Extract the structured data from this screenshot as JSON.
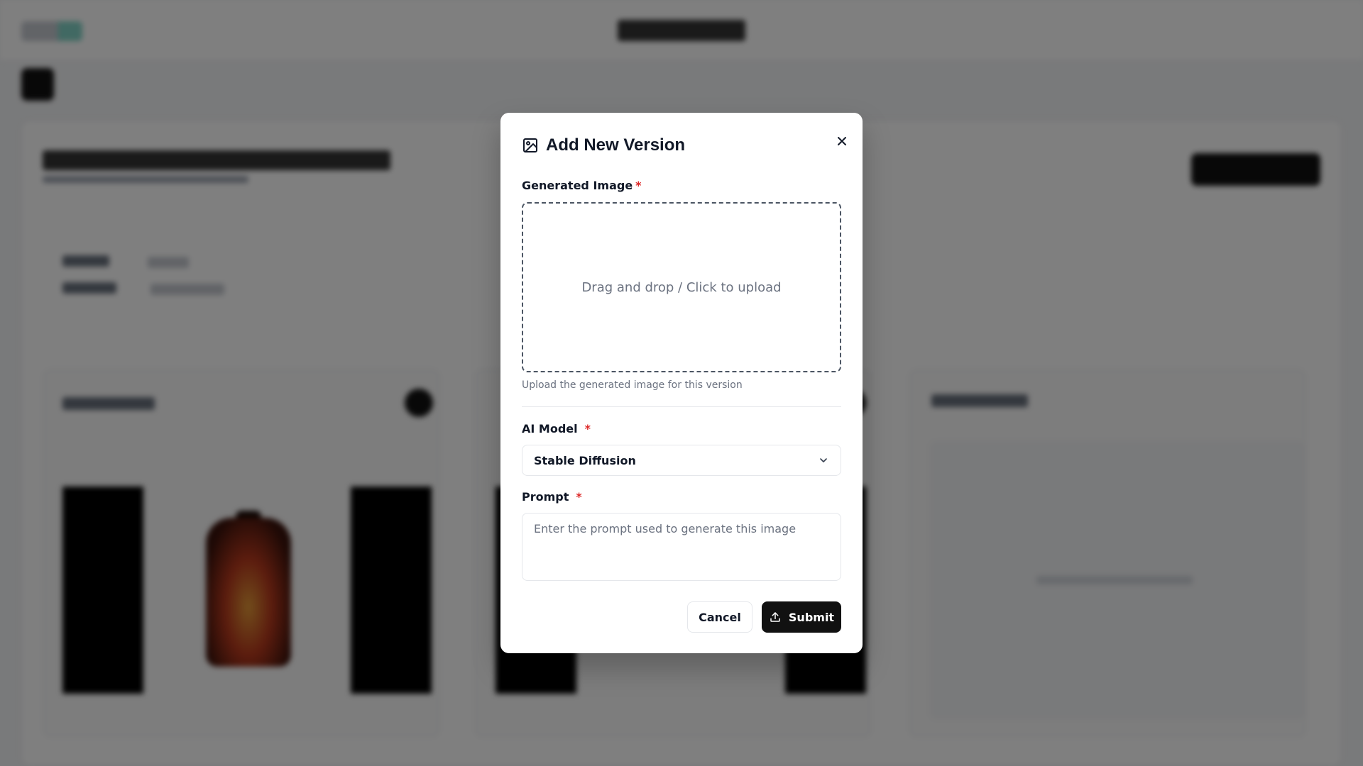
{
  "modal": {
    "title": "Add New Version",
    "title_icon": "image-icon",
    "close_icon": "close-icon",
    "generated_image": {
      "label": "Generated Image",
      "required_mark": "*",
      "dropzone_text": "Drag and drop / Click to upload",
      "help_text": "Upload the generated image for this version"
    },
    "ai_model": {
      "label": "AI Model",
      "required_mark": "*",
      "selected": "Stable Diffusion",
      "icon": "chevron-down-icon"
    },
    "prompt": {
      "label": "Prompt",
      "required_mark": "*",
      "placeholder": "Enter the prompt used to generate this image",
      "value": ""
    },
    "buttons": {
      "cancel": "Cancel",
      "submit": "Submit",
      "submit_icon": "upload-icon"
    }
  },
  "colors": {
    "required": "#dc2626",
    "primary": "#111111",
    "overlay": "rgba(0,0,0,0.5)"
  }
}
